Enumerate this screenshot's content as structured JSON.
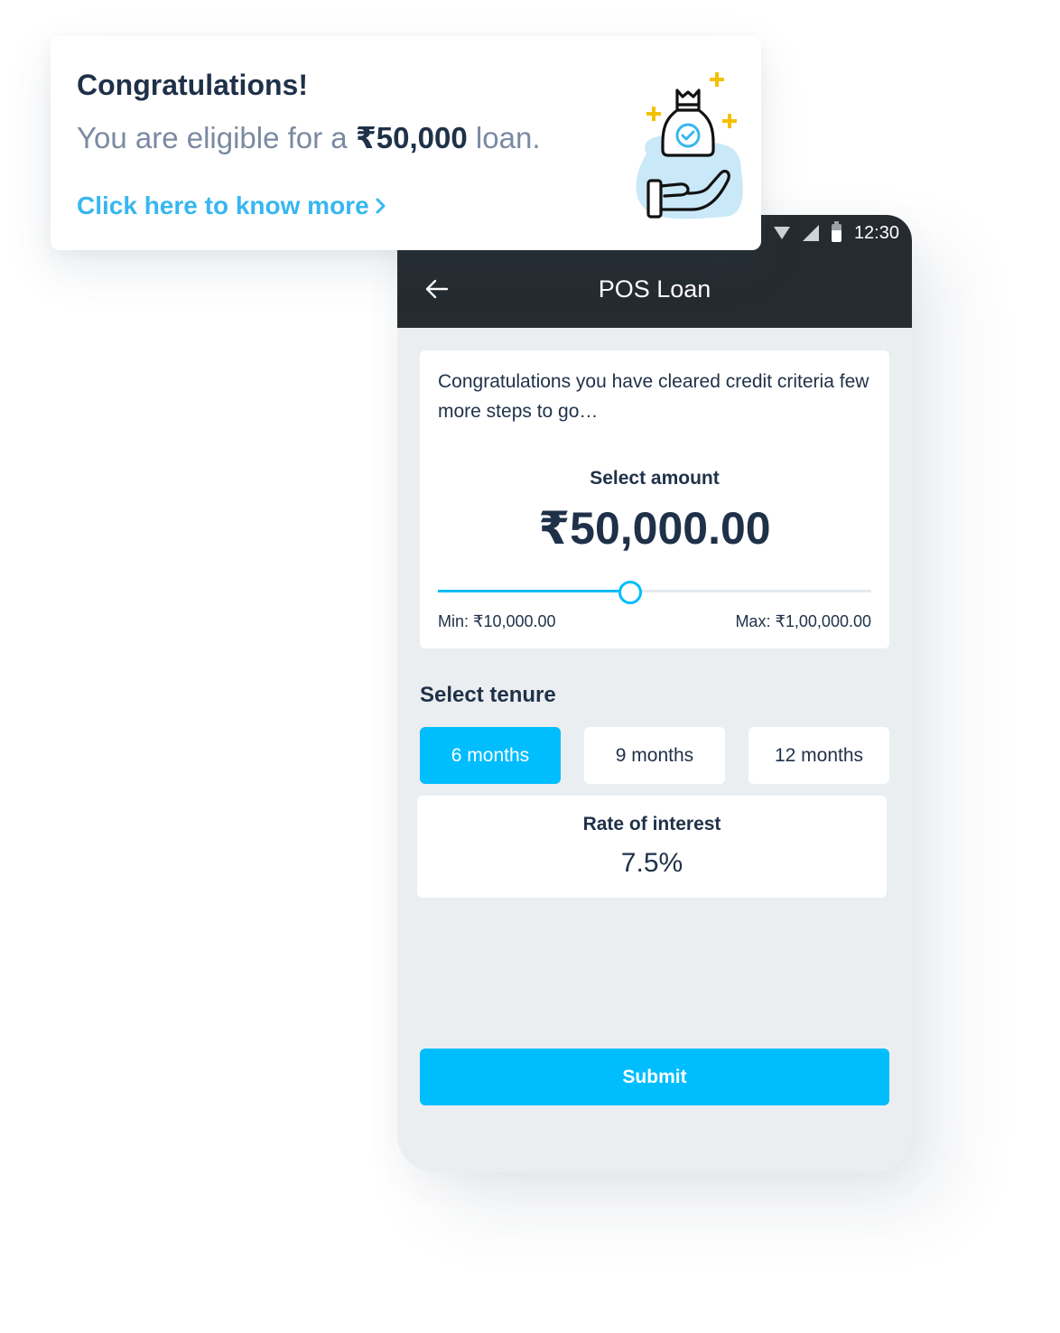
{
  "popup": {
    "title": "Congratulations!",
    "eligible_prefix": "You are eligible for a",
    "eligible_amount": "₹50,000",
    "eligible_suffix": "loan.",
    "link_label": "Click here to know more",
    "link_icon": "chevron-right-icon",
    "illustration": "money-bag-hand-icon"
  },
  "statusbar": {
    "icons": [
      "wifi-icon",
      "signal-icon",
      "battery-icon"
    ],
    "time": "12:30"
  },
  "appbar": {
    "back_icon": "arrow-left-icon",
    "title": "POS Loan"
  },
  "amount_card": {
    "intro": "Congratulations you have cleared credit criteria few more steps to go…",
    "select_label": "Select amount",
    "amount": "₹50,000.00",
    "slider": {
      "min_value": 10000,
      "max_value": 100000,
      "value": 50000
    },
    "min_label": "Min: ₹10,000.00",
    "max_label": "Max: ₹1,00,000.00"
  },
  "tenure": {
    "title": "Select tenure",
    "options": [
      {
        "label": "6 months",
        "selected": true
      },
      {
        "label": "9 months",
        "selected": false
      },
      {
        "label": "12 months",
        "selected": false
      }
    ]
  },
  "interest": {
    "label": "Rate of interest",
    "value": "7.5%"
  },
  "submit_label": "Submit",
  "colors": {
    "accent": "#00bdfd",
    "link": "#37b7ef",
    "text_dark": "#1f3149",
    "text_muted": "#7a8aa2",
    "appbar_bg": "#252b30",
    "screen_bg": "#ebeef0",
    "sparkle": "#f5c000"
  }
}
